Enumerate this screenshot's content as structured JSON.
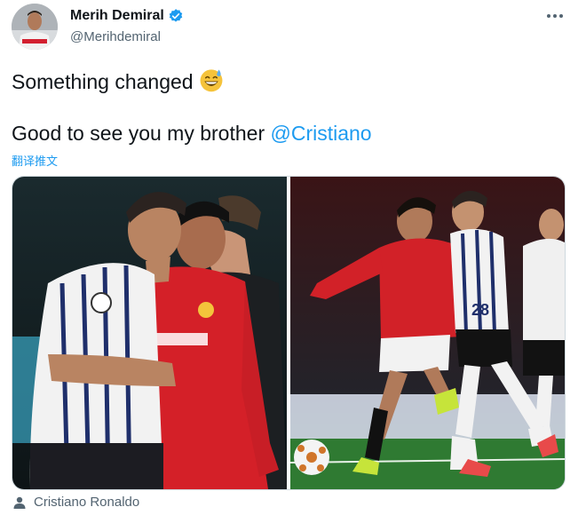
{
  "tweet": {
    "author": {
      "display_name": "Merih Demiral",
      "handle": "@Merihdemiral",
      "avatar_icon": "avatar-image",
      "verified_icon": "verified-badge-icon",
      "verified_color": "#1d9bf0"
    },
    "more_icon": "more-options-icon",
    "text_line1": "Something changed",
    "emoji_icon": "grinning-face-with-sweat-emoji",
    "text_line2_prefix": "Good to see you my brother ",
    "mention": "@Cristiano",
    "translate_label": "翻译推文",
    "media": [
      {
        "icon": "photo-players-walking"
      },
      {
        "icon": "photo-match-action"
      }
    ],
    "tagged": {
      "icon": "person-tag-icon",
      "name": "Cristiano Ronaldo"
    }
  },
  "colors": {
    "link": "#1d9bf0",
    "text": "#0f1419",
    "secondary": "#536471",
    "border": "#cfd9de"
  }
}
